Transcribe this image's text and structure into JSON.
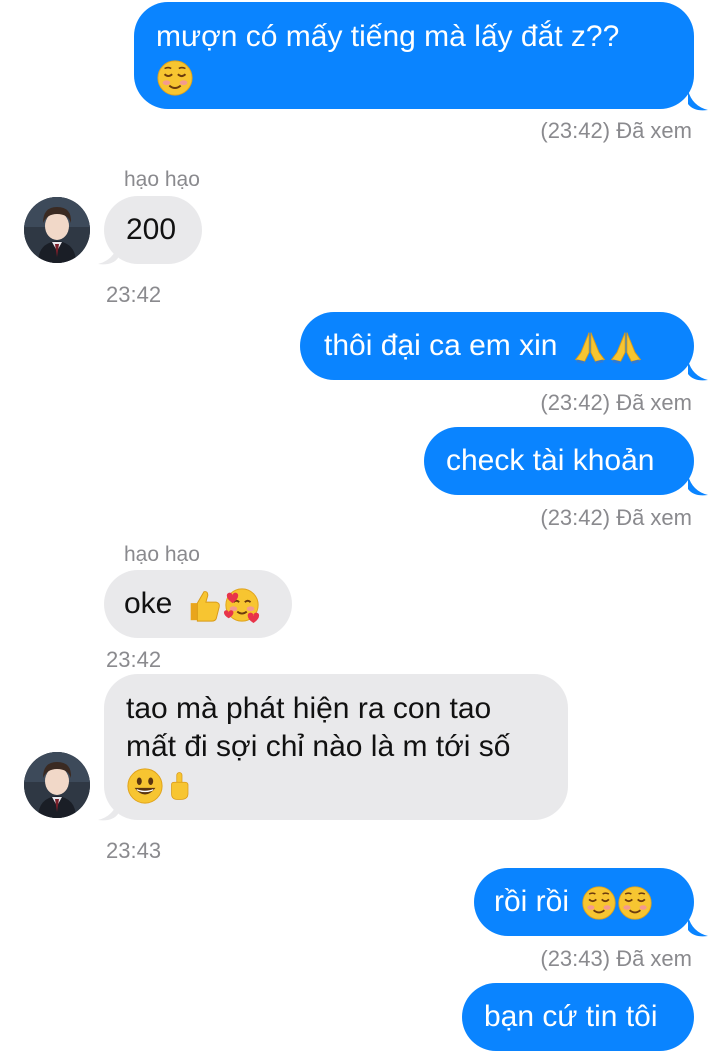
{
  "contact": {
    "name": "hạo hạo"
  },
  "messages": [
    {
      "dir": "out",
      "lines": [
        "mượn có mấy tiếng mà lấy đắt z??"
      ],
      "emoji": [
        "relieved-smile"
      ],
      "status": "(23:42) Đã xem"
    },
    {
      "dir": "in",
      "sender": "hạo hạo",
      "text": "200",
      "time": "23:42"
    },
    {
      "dir": "out",
      "text": "thôi đại ca em xin",
      "emoji": [
        "folded-hands",
        "folded-hands"
      ],
      "status": "(23:42) Đã xem"
    },
    {
      "dir": "out",
      "text": "check tài khoản",
      "status": "(23:42) Đã xem"
    },
    {
      "dir": "in",
      "sender": "hạo hạo",
      "text": "oke",
      "emoji": [
        "thumbs-up",
        "smiling-face-with-hearts"
      ],
      "time": "23:42"
    },
    {
      "dir": "in",
      "lines": [
        "tao mà phát hiện ra con tao",
        "mất đi sợi chỉ nào là m tới số"
      ],
      "emoji": [
        "grinning-face",
        "pointing-finger"
      ],
      "time": "23:43"
    },
    {
      "dir": "out",
      "text": "rồi rồi",
      "emoji": [
        "relieved-smile",
        "relieved-smile"
      ],
      "status": "(23:43) Đã xem"
    },
    {
      "dir": "out",
      "text": "bạn cứ tin tôi"
    }
  ],
  "colors": {
    "outgoing": "#0a84ff",
    "incoming": "#e9e9eb",
    "meta": "#8a8a8e"
  }
}
